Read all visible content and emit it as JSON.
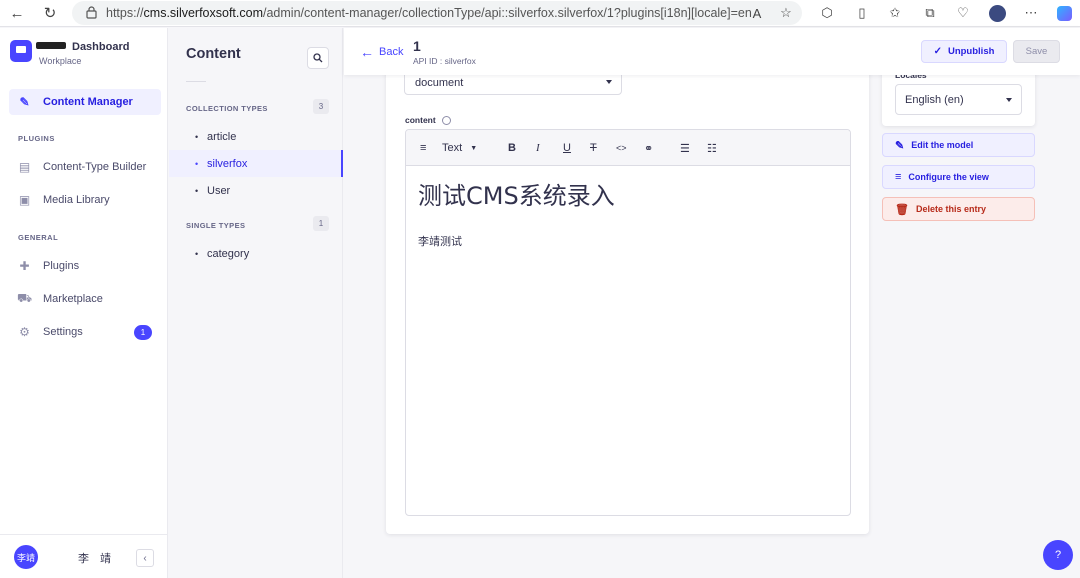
{
  "browser": {
    "url_prefix": "https://",
    "url_domain": "cms.silverfoxsoft.com",
    "url_path": "/admin/content-manager/collectionType/api::silverfox.silverfox/1?plugins[i18n][locale]=en"
  },
  "sidebar": {
    "brand_title": "Dashboard",
    "brand_subtitle": "Workplace",
    "content_manager": "Content Manager",
    "plugins_heading": "PLUGINS",
    "content_type_builder": "Content-Type Builder",
    "media_library": "Media Library",
    "general_heading": "GENERAL",
    "plugins": "Plugins",
    "marketplace": "Marketplace",
    "settings": "Settings",
    "settings_badge": "1",
    "user_initials": "李靖",
    "user_name": "李 靖"
  },
  "content_nav": {
    "title": "Content",
    "collection_types_heading": "COLLECTION TYPES",
    "collection_types_count": "3",
    "collection_types": [
      "article",
      "silverfox",
      "User"
    ],
    "single_types_heading": "SINGLE TYPES",
    "single_types_count": "1",
    "single_types": [
      "category"
    ]
  },
  "header": {
    "back_label": "Back",
    "entry_title": "1",
    "api_id": "API ID : silverfox",
    "unpublish_label": "Unpublish",
    "save_label": "Save"
  },
  "editor": {
    "type_value": "document",
    "content_label": "content",
    "block_style": "Text",
    "heading_text": "测试CMS系统录入",
    "paragraph_text": "李靖测试"
  },
  "side_panel": {
    "locales_label": "Locales",
    "locale_value": "English (en)",
    "edit_model": "Edit the model",
    "configure_view": "Configure the view",
    "delete_entry": "Delete this entry"
  },
  "help": {
    "label": "?"
  },
  "colors": {
    "accent": "#4945ff",
    "accent_text": "#271fe0",
    "danger": "#b72b1a"
  }
}
